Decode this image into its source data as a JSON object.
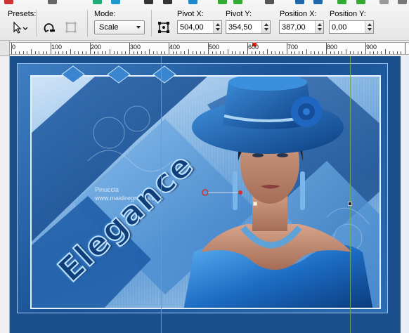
{
  "toolbar": {
    "presets_label": "Presets:",
    "mode_label": "Mode:",
    "mode_value": "Scale",
    "pivot_x_label": "Pivot X:",
    "pivot_x_value": "504,00",
    "pivot_y_label": "Pivot Y:",
    "pivot_y_value": "354,50",
    "position_x_label": "Position X:",
    "position_x_value": "387,00",
    "position_y_label": "Position Y:",
    "position_y_value": "0,00"
  },
  "ruler": {
    "labels": [
      "0",
      "100",
      "200",
      "300",
      "400",
      "500",
      "600",
      "700",
      "800",
      "900"
    ]
  },
  "canvas": {
    "watermark_line1": "Pinuccia",
    "watermark_line2": "www.maidiregrafica.eu",
    "title_text": "Elegance"
  },
  "colors": {
    "accent_blue": "#1c4f8d",
    "guide_green": "#78aa5a",
    "marker_red": "#e21"
  }
}
